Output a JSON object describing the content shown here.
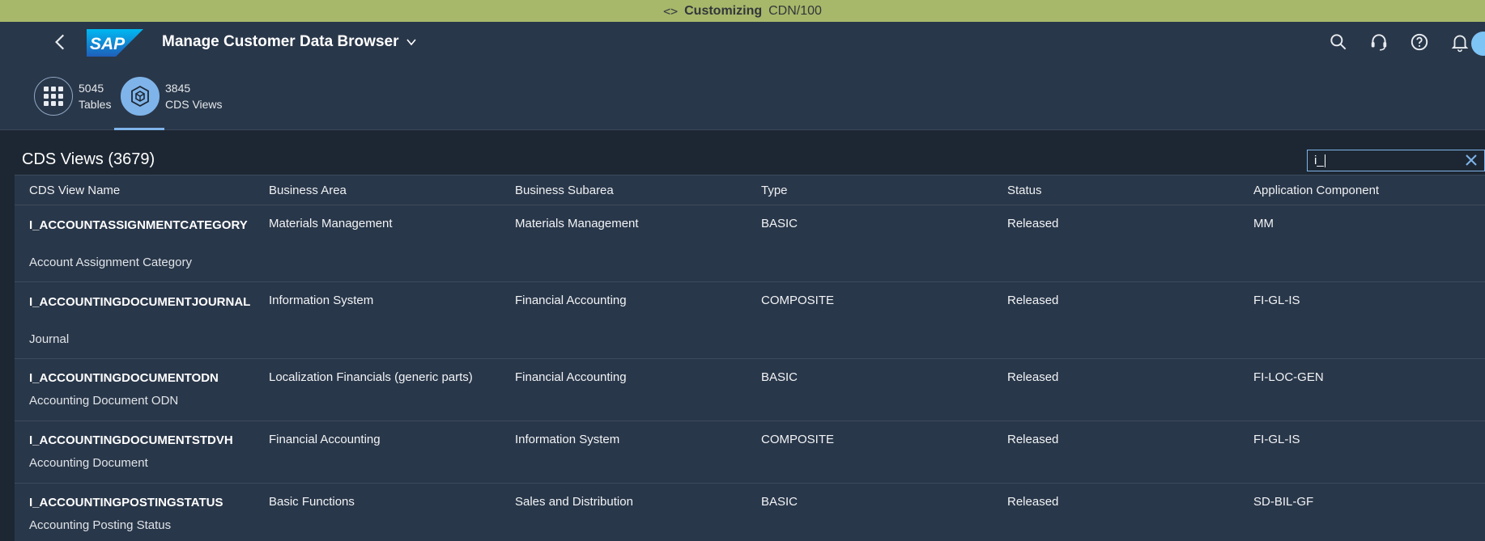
{
  "system": {
    "context_label": "Customizing",
    "client": "CDN/100"
  },
  "shell": {
    "app_title": "Manage Customer Data Browser",
    "logo_text": "SAP"
  },
  "tabs": [
    {
      "count": "5045",
      "label": "Tables",
      "icon": "grid-icon"
    },
    {
      "count": "3845",
      "label": "CDS Views",
      "icon": "cube-icon",
      "selected": true
    }
  ],
  "list": {
    "title": "CDS Views (3679)"
  },
  "search": {
    "value": "i_"
  },
  "columns": [
    "CDS View Name",
    "Business Area",
    "Business Subarea",
    "Type",
    "Status",
    "Application Component"
  ],
  "rows": [
    {
      "name": "I_ACCOUNTASSIGNMENTCATEGORY",
      "desc": "Account Assignment Category",
      "area": "Materials Management",
      "subarea": "Materials Management",
      "type": "BASIC",
      "status": "Released",
      "component": "MM"
    },
    {
      "name": "I_ACCOUNTINGDOCUMENTJOURNAL",
      "desc": "Journal",
      "area": "Information System",
      "subarea": "Financial Accounting",
      "type": "COMPOSITE",
      "status": "Released",
      "component": "FI-GL-IS"
    },
    {
      "name": "I_ACCOUNTINGDOCUMENTODN",
      "desc": "Accounting Document ODN",
      "area": "Localization Financials (generic parts)",
      "subarea": "Financial Accounting",
      "type": "BASIC",
      "status": "Released",
      "component": "FI-LOC-GEN"
    },
    {
      "name": "I_ACCOUNTINGDOCUMENTSTDVH",
      "desc": "Accounting Document",
      "area": "Financial Accounting",
      "subarea": "Information System",
      "type": "COMPOSITE",
      "status": "Released",
      "component": "FI-GL-IS"
    },
    {
      "name": "I_ACCOUNTINGPOSTINGSTATUS",
      "desc": "Accounting Posting Status",
      "area": "Basic Functions",
      "subarea": "Sales and Distribution",
      "type": "BASIC",
      "status": "Released",
      "component": "SD-BIL-GF"
    }
  ],
  "colors": {
    "shell": "#29374a",
    "background": "#1d2733",
    "accent": "#7fb4ea",
    "system_banner": "#a7b86a"
  }
}
